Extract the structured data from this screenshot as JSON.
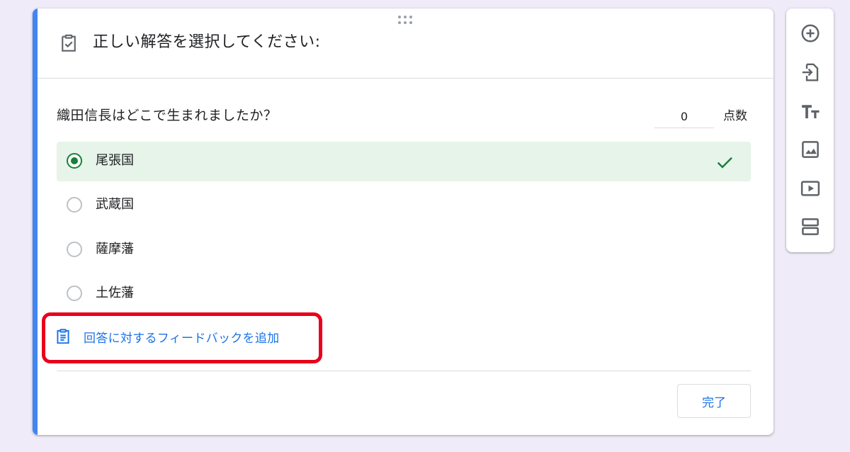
{
  "header": {
    "title": "正しい解答を選択してください:"
  },
  "question": {
    "text": "織田信長はどこで生まれましたか？",
    "points_value": "0",
    "points_label": "点数"
  },
  "options": [
    {
      "label": "尾張国",
      "selected": true,
      "correct": true
    },
    {
      "label": "武蔵国",
      "selected": false
    },
    {
      "label": "薩摩藩",
      "selected": false
    },
    {
      "label": "土佐藩",
      "selected": false
    }
  ],
  "feedback": {
    "label": "回答に対するフィードバックを追加"
  },
  "footer": {
    "done_label": "完了"
  },
  "sidebar": {
    "tools": [
      "add-question-icon",
      "import-questions-icon",
      "add-title-icon",
      "add-image-icon",
      "add-video-icon",
      "add-section-icon"
    ]
  },
  "colors": {
    "accent": "#4285f4",
    "correct_bg": "#e6f4ea",
    "correct_green": "#188038",
    "link_blue": "#1a73e8",
    "highlight_red": "#e8001c",
    "page_bg": "#f0ebf8"
  }
}
